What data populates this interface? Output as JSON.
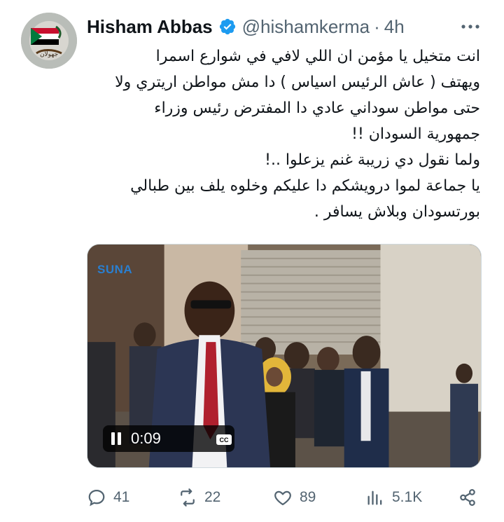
{
  "tweet": {
    "author_name": "Hisham Abbas",
    "handle": "@hishamkerma",
    "separator": "·",
    "time": "4h",
    "avatar_text": "جهولان",
    "text_lines": [
      "انت متخيل يا مؤمن ان اللي لافي في شوارع اسمرا",
      "ويهتف ( عاش الرئيس اسياس ) دا مش مواطن اريتري ولا",
      "حتى مواطن سوداني عادي دا المفترض رئيس وزراء",
      "جمهورية السودان !!",
      "ولما نقول دي زريبة غنم يزعلوا ..!",
      "يا جماعة لموا درويشكم دا عليكم وخلوه يلف بين طبالي",
      "بورتسودان وبلاش يسافر ."
    ]
  },
  "media": {
    "watermark": "SUNA",
    "duration": "0:09",
    "cc_label": "CC"
  },
  "actions": {
    "replies": "41",
    "reposts": "22",
    "likes": "89",
    "views": "5.1K"
  },
  "colors": {
    "text": "#0f1419",
    "muted": "#536471",
    "verified": "#1d9bf0"
  },
  "icons": [
    "verified-badge-icon",
    "more-icon",
    "pause-icon",
    "cc-icon",
    "reply-icon",
    "repost-icon",
    "like-icon",
    "views-icon",
    "share-icon"
  ]
}
